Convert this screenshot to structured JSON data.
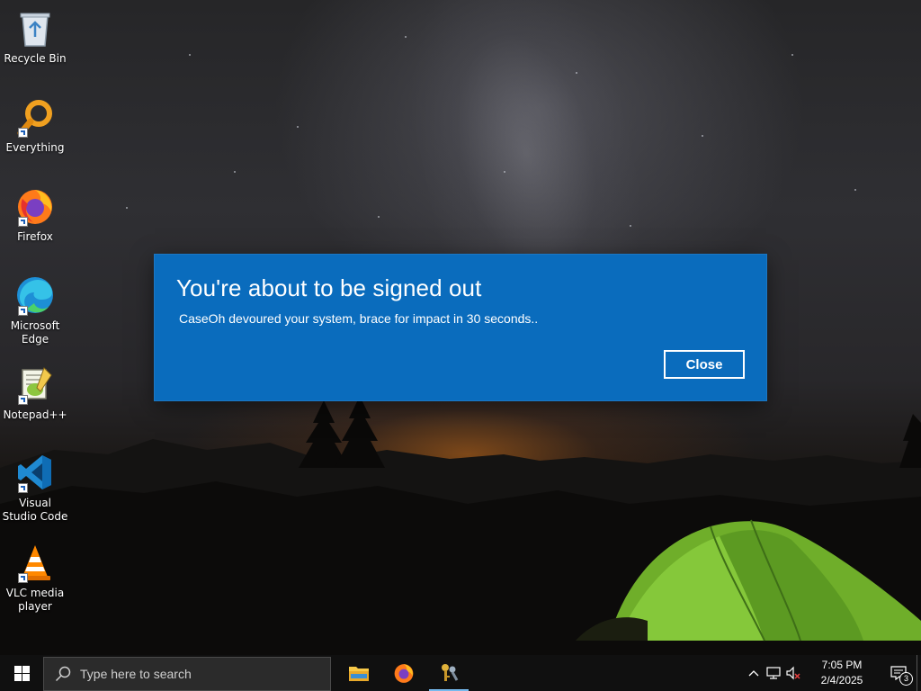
{
  "desktop": {
    "icons": [
      {
        "label": "Recycle Bin",
        "icon": "recycle-bin-icon"
      },
      {
        "label": "Everything",
        "icon": "everything-search-icon"
      },
      {
        "label": "Firefox",
        "icon": "firefox-icon"
      },
      {
        "label": "Microsoft Edge",
        "icon": "edge-icon"
      },
      {
        "label": "Notepad++",
        "icon": "notepad-plus-plus-icon"
      },
      {
        "label": "Visual Studio Code",
        "icon": "vscode-icon"
      },
      {
        "label": "VLC media player",
        "icon": "vlc-icon"
      }
    ]
  },
  "dialog": {
    "title": "You're about to be signed out",
    "message": "CaseOh devoured your system, brace for impact in 30 seconds..",
    "close_label": "Close",
    "background": "#0a6cbd"
  },
  "taskbar": {
    "search_placeholder": "Type here to search",
    "apps": [
      {
        "name": "file-explorer-icon"
      },
      {
        "name": "firefox-icon"
      },
      {
        "name": "keys-app-icon",
        "active": true
      }
    ],
    "tray": {
      "time": "7:05 PM",
      "date": "2/4/2025",
      "notification_count": "3"
    }
  }
}
